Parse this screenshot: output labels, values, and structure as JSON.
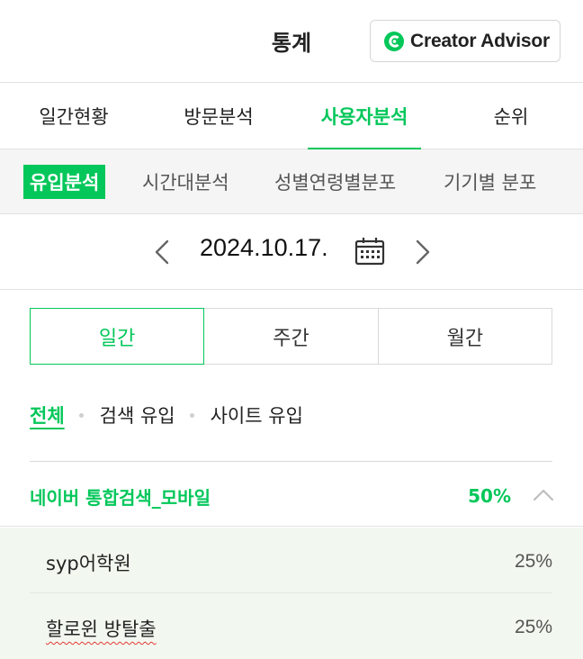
{
  "header": {
    "title": "통계",
    "creator_advisor_label": "Creator Advisor"
  },
  "main_tabs": [
    {
      "label": "일간현황",
      "active": false
    },
    {
      "label": "방문분석",
      "active": false
    },
    {
      "label": "사용자분석",
      "active": true
    },
    {
      "label": "순위",
      "active": false
    }
  ],
  "sub_tabs": [
    {
      "label": "유입분석",
      "active": true
    },
    {
      "label": "시간대분석",
      "active": false
    },
    {
      "label": "성별연령별분포",
      "active": false
    },
    {
      "label": "기기별 분포",
      "active": false
    }
  ],
  "date_nav": {
    "date": "2024.10.17."
  },
  "period": [
    {
      "label": "일간",
      "active": true
    },
    {
      "label": "주간",
      "active": false
    },
    {
      "label": "월간",
      "active": false
    }
  ],
  "filter": [
    {
      "label": "전체",
      "active": true
    },
    {
      "label": "검색 유입",
      "active": false
    },
    {
      "label": "사이트 유입",
      "active": false
    }
  ],
  "source_group": {
    "label": "네이버 통합검색_모바일",
    "percent": "50%",
    "expanded": true,
    "keywords": [
      {
        "label": "syp어학원",
        "percent": "25%"
      },
      {
        "label": "할로윈 방탈출",
        "percent": "25%"
      }
    ]
  },
  "colors": {
    "accent": "#03c75a",
    "keyword_bg": "#f2f8ef"
  }
}
